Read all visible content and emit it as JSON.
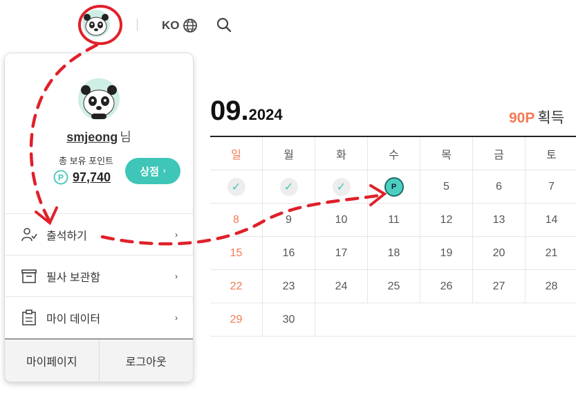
{
  "header": {
    "language": "KO",
    "icons": {
      "language": "globe-icon",
      "search": "search-icon"
    }
  },
  "dropdown": {
    "username": "smjeong",
    "honorific": "님",
    "points_label": "총 보유 포인트",
    "points_value": "97,740",
    "points_icon": "P",
    "shop_label": "상점",
    "menu": [
      {
        "label": "출석하기",
        "icon": "user-check-icon"
      },
      {
        "label": "필사 보관함",
        "icon": "archive-box-icon"
      },
      {
        "label": "마이 데이터",
        "icon": "clipboard-icon"
      }
    ],
    "footer": {
      "mypage": "마이페이지",
      "logout": "로그아웃"
    }
  },
  "calendar": {
    "month": "09.",
    "year": "2024",
    "earned_points": "90P",
    "earned_label": "획득",
    "weekdays": [
      "일",
      "월",
      "화",
      "수",
      "목",
      "금",
      "토"
    ],
    "weeks": [
      [
        "✓",
        "✓",
        "✓",
        "P",
        "5",
        "6",
        "7"
      ],
      [
        "8",
        "9",
        "10",
        "11",
        "12",
        "13",
        "14"
      ],
      [
        "15",
        "16",
        "17",
        "18",
        "19",
        "20",
        "21"
      ],
      [
        "22",
        "23",
        "24",
        "25",
        "26",
        "27",
        "28"
      ],
      [
        "29",
        "30",
        "",
        "",
        "",
        "",
        ""
      ]
    ]
  },
  "colors": {
    "accent": "#3fc6b8",
    "sunday": "#f27b53",
    "annotation": "#e0202a"
  }
}
